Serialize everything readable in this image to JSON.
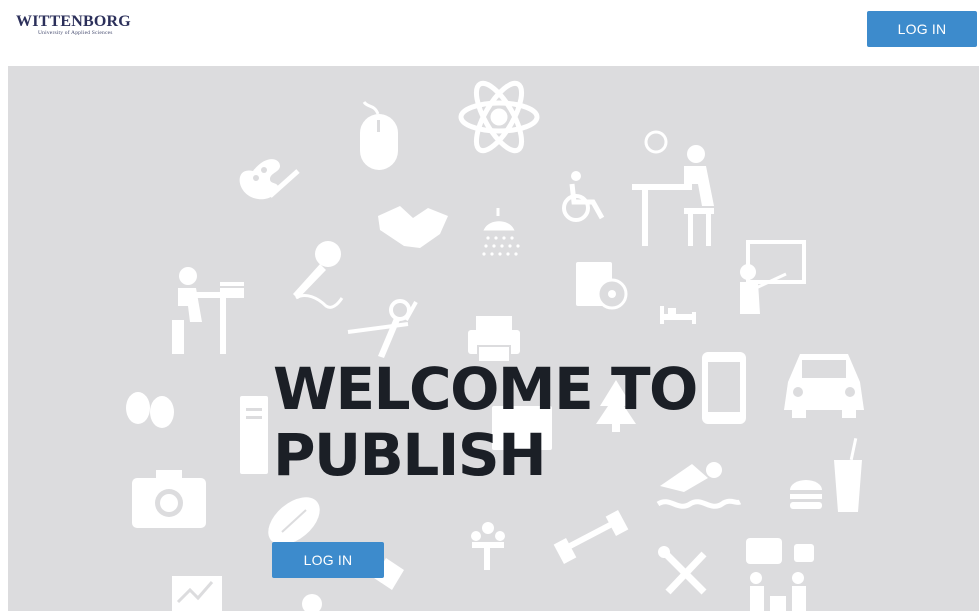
{
  "header": {
    "logo_name": "WITTENBORG",
    "logo_subtitle": "University of Applied Sciences",
    "login_label": "LOG IN"
  },
  "hero": {
    "title_line1": "WELCOME TO",
    "title_line2": "PUBLISH",
    "login_label": "LOG IN",
    "background_color": "#dcdcde",
    "icon_color": "#ffffff",
    "icons": [
      "atom-icon",
      "mouse-icon",
      "palette-icon",
      "handshake-icon",
      "shower-icon",
      "wheelchair-icon",
      "student-desk-icon",
      "teacher-board-icon",
      "microphone-icon",
      "student-reading-icon",
      "dvd-icon",
      "bed-icon",
      "compass-icon",
      "printer-icon",
      "tablet-icon",
      "car-icon",
      "theater-masks-icon",
      "computer-tower-icon",
      "tree-icon",
      "swimmer-icon",
      "burger-drink-icon",
      "camera-icon",
      "football-icon",
      "meeting-icon",
      "dumbbell-icon",
      "tools-icon",
      "chat-group-icon",
      "chart-icon"
    ]
  },
  "colors": {
    "accent": "#3d8bcc",
    "title": "#1b1f26",
    "logo": "#2b2f5a"
  }
}
